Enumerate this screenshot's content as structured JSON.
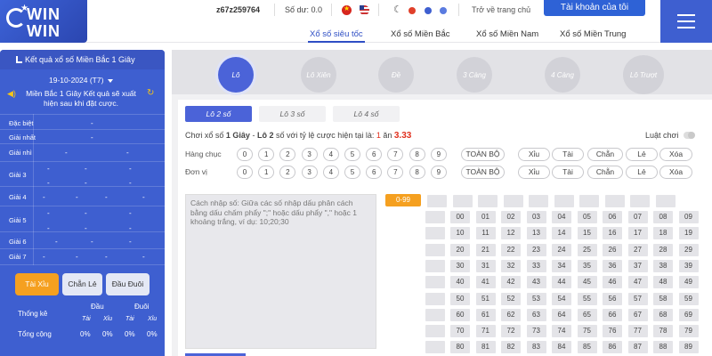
{
  "header": {
    "username": "z67z259764",
    "balance_label": "Số dư: 0.0",
    "home_link": "Trở về trang chủ",
    "account_button": "Tài khoản của tôi",
    "logo_text_1": "WIN",
    "logo_text_2": "WIN",
    "nav": [
      "Xổ số siêu tốc",
      "Xổ số Miền Bắc",
      "Xổ số Miền Nam",
      "Xổ số Miền Trung"
    ],
    "accent": "#3e5fd0"
  },
  "left": {
    "title": "Kết quả xổ số Miền Bắc 1 Giây",
    "date": "19-10-2024 (T7)",
    "note": "Miền Bắc 1 Giây Kết quả sẽ xuất hiện sau khi đặt cược.",
    "rows": [
      {
        "label": "Đặc biệt",
        "values": [
          "-"
        ]
      },
      {
        "label": "Giải nhất",
        "values": [
          "-"
        ]
      },
      {
        "label": "Giải nhì",
        "values": [
          "-",
          "-"
        ]
      },
      {
        "label": "Giải 3",
        "values": [
          "-",
          "-",
          "-",
          "-",
          "-",
          "-"
        ]
      },
      {
        "label": "Giải 4",
        "values": [
          "-",
          "-",
          "-",
          "-"
        ]
      },
      {
        "label": "Giải 5",
        "values": [
          "-",
          "-",
          "-",
          "-",
          "-",
          "-"
        ]
      },
      {
        "label": "Giải 6",
        "values": [
          "-",
          "-",
          "-"
        ]
      },
      {
        "label": "Giải 7",
        "values": [
          "-",
          "-",
          "-",
          "-"
        ]
      }
    ],
    "tabs": [
      "Tài Xỉu",
      "Chẵn Lẻ",
      "Đầu Đuôi"
    ],
    "stats": {
      "title": "Thống kê",
      "dau": "Đầu",
      "duoi": "Đuôi",
      "tai": "Tài",
      "xiu": "Xỉu",
      "total_label": "Tổng cộng",
      "values": [
        "0%",
        "0%",
        "0%",
        "0%"
      ]
    }
  },
  "game_tabs": [
    "Lô",
    "Lô Xiên",
    "Đề",
    "3 Càng",
    "4 Càng",
    "Lô Trượt"
  ],
  "sub_tabs": [
    "Lô 2 số",
    "Lô 3 số",
    "Lô 4 số"
  ],
  "rule": {
    "prefix": "Chơi xổ số ",
    "game": "1 Giây",
    "middle": " - ",
    "type": "Lô 2",
    "suffix": " số với tỷ lệ cược hiện tại là: ",
    "ratio_a": "1",
    "ratio_mid": " ăn ",
    "ratio_b": "3.33",
    "luat": "Luật chơi"
  },
  "rows": [
    {
      "label": "Hàng chục"
    },
    {
      "label": "Đơn vị"
    }
  ],
  "digits": [
    "0",
    "1",
    "2",
    "3",
    "4",
    "5",
    "6",
    "7",
    "8",
    "9"
  ],
  "pills": [
    "TOÀN BỘ",
    "Xỉu",
    "Tài",
    "Chẵn",
    "Lẻ",
    "Xóa"
  ],
  "input_placeholder": "Cách nhập số: Giữa các số nhập dấu phân cách bằng dấu chấm phẩy \";\" hoặc dấu phẩy \",\" hoặc 1 khoảng trắng, ví dụ: 10;20;30",
  "range_button": "0-99",
  "numbers": [
    "00",
    "01",
    "02",
    "03",
    "04",
    "05",
    "06",
    "07",
    "08",
    "09",
    "10",
    "11",
    "12",
    "13",
    "14",
    "15",
    "16",
    "17",
    "18",
    "19",
    "20",
    "21",
    "22",
    "23",
    "24",
    "25",
    "26",
    "27",
    "28",
    "29",
    "30",
    "31",
    "32",
    "33",
    "34",
    "35",
    "36",
    "37",
    "38",
    "39",
    "40",
    "41",
    "42",
    "43",
    "44",
    "45",
    "46",
    "47",
    "48",
    "49",
    "50",
    "51",
    "52",
    "53",
    "54",
    "55",
    "56",
    "57",
    "58",
    "59",
    "60",
    "61",
    "62",
    "63",
    "64",
    "65",
    "66",
    "67",
    "68",
    "69",
    "70",
    "71",
    "72",
    "73",
    "74",
    "75",
    "76",
    "77",
    "78",
    "79",
    "80",
    "81",
    "82",
    "83",
    "84",
    "85",
    "86",
    "87",
    "88",
    "89"
  ]
}
